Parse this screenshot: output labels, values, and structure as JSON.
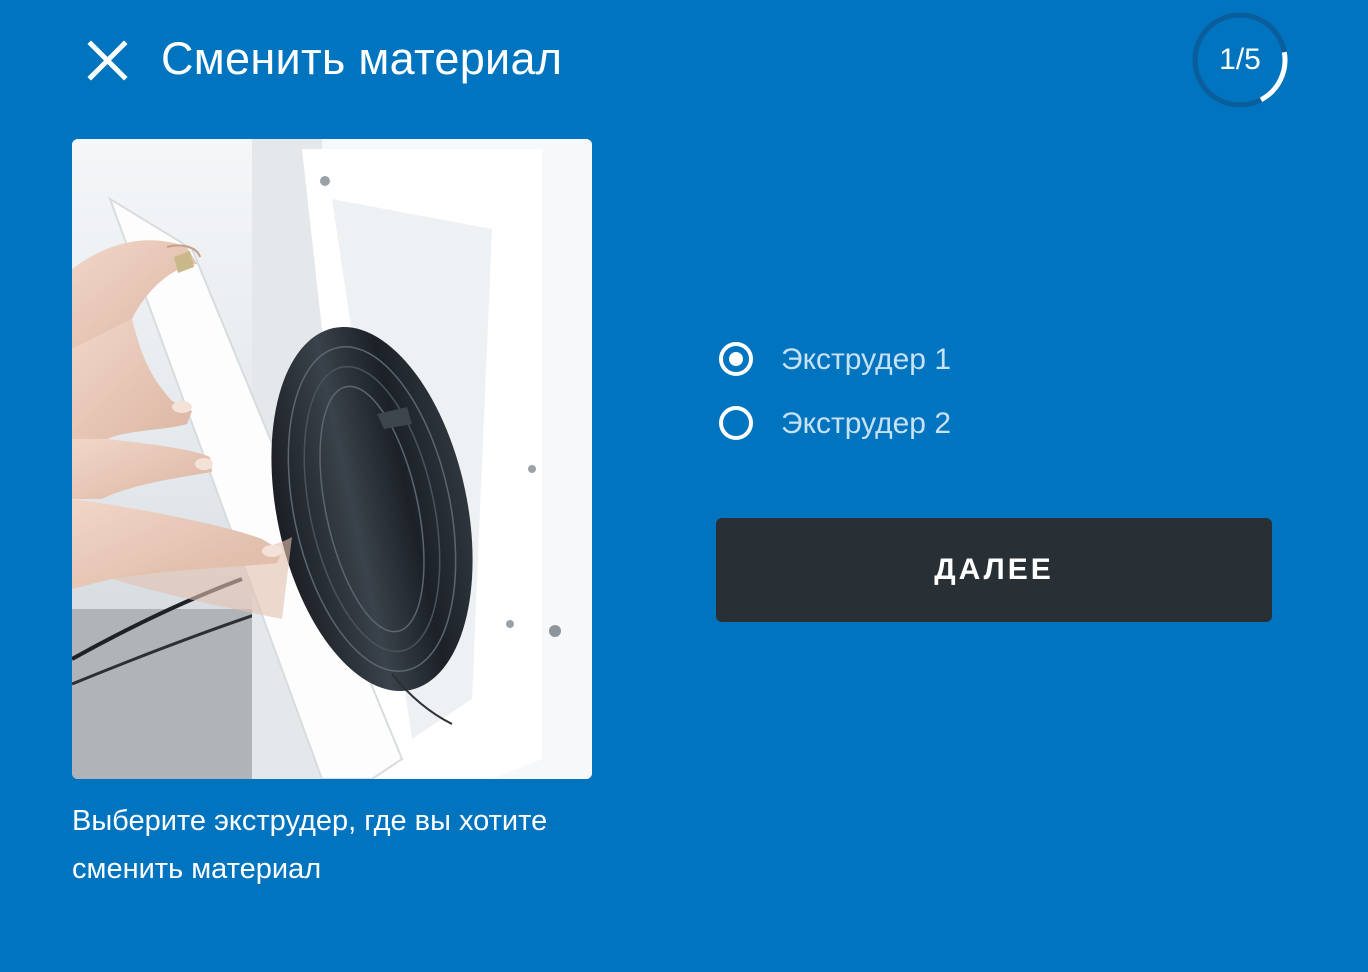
{
  "header": {
    "title": "Сменить материал",
    "step": "1/5",
    "step_progress": 0.2
  },
  "illustration": {
    "subject": "hand mounting a black filament spool on a white printer spool holder"
  },
  "instruction": {
    "text": "Выберите экструдер, где вы хотите сменить материал"
  },
  "extruders": {
    "options": [
      {
        "label": "Экструдер 1",
        "selected": true
      },
      {
        "label": "Экструдер 2",
        "selected": false
      }
    ]
  },
  "actions": {
    "next_label": "ДАЛЕЕ"
  },
  "colors": {
    "background": "#0074bf",
    "button": "#282f35",
    "progress_track": "#0a5e9c",
    "progress_fill": "#ffffff",
    "radio_label": "#c8e1f3"
  },
  "icons": {
    "close": "close-icon",
    "radio_selected": "radio-selected-icon",
    "radio_unselected": "radio-unselected-icon"
  }
}
